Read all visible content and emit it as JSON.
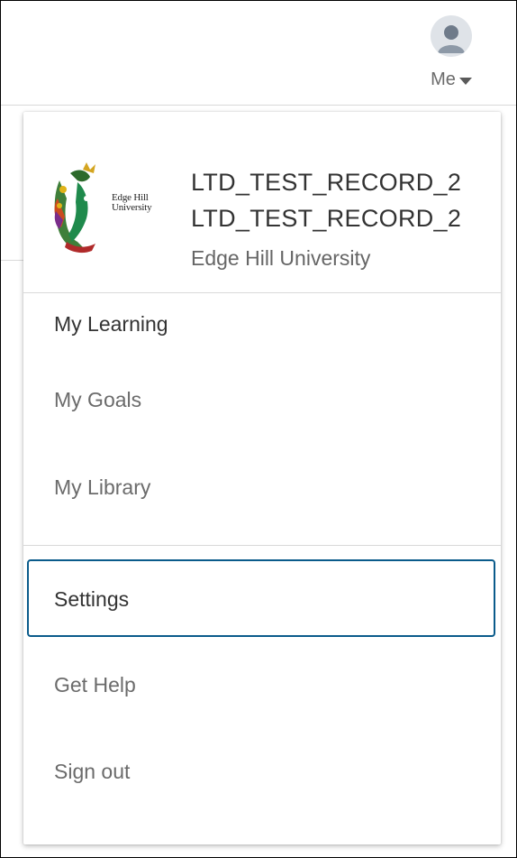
{
  "header": {
    "me_label": "Me",
    "avatar_icon": "user-avatar-icon",
    "caret_icon": "caret-down-icon"
  },
  "profile": {
    "logo_text_line1": "Edge Hill",
    "logo_text_line2": "University",
    "name_line1": "LTD_TEST_RECORD_2",
    "name_line2": "LTD_TEST_RECORD_2",
    "organization": "Edge Hill University"
  },
  "menu": {
    "section_title": "My Learning",
    "items": [
      {
        "label": "My Goals"
      },
      {
        "label": "My Library"
      },
      {
        "label": "Settings",
        "focused": true
      },
      {
        "label": "Get Help"
      },
      {
        "label": "Sign out"
      }
    ]
  },
  "colors": {
    "focus_border": "#0a5b8b",
    "text_primary": "#333333",
    "text_secondary": "#6b6b6b"
  }
}
